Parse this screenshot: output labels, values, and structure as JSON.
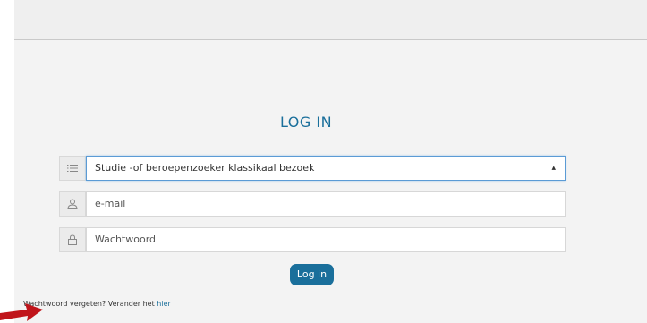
{
  "login": {
    "title": "LOG IN",
    "select_value": "Studie -of beroepenzoeker klassikaal bezoek",
    "email_placeholder": "e-mail",
    "password_placeholder": "Wachtwoord",
    "submit_label": "Log in",
    "forgot_text": "Wachtwoord vergeten? Verander het",
    "forgot_link": "hier"
  },
  "icons": {
    "select": "list-icon",
    "email": "user-icon",
    "password": "lock-icon",
    "annotation": "red-arrow"
  },
  "colors": {
    "accent": "#1a6f9b",
    "annotation_arrow": "#c0141a"
  }
}
